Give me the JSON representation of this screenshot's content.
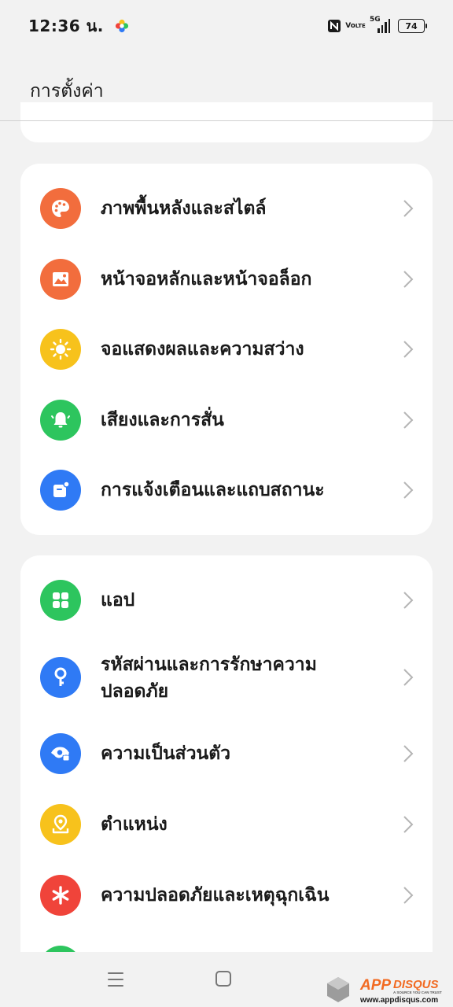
{
  "status_bar": {
    "time": "12:36 น.",
    "volte_line1": "Vo",
    "volte_line2": "LTE",
    "network": "5G",
    "battery": "74"
  },
  "header": {
    "title": "การตั้งค่า"
  },
  "groups": [
    {
      "items": [
        {
          "label": "ภาพพื้นหลังและสไตล์",
          "icon": "palette-icon",
          "color": "#f26d3d"
        },
        {
          "label": "หน้าจอหลักและหน้าจอล็อก",
          "icon": "image-icon",
          "color": "#f26d3d"
        },
        {
          "label": "จอแสดงผลและความสว่าง",
          "icon": "sun-icon",
          "color": "#f7c21c"
        },
        {
          "label": "เสียงและการสั่น",
          "icon": "bell-icon",
          "color": "#2dc55e"
        },
        {
          "label": "การแจ้งเตือนและแถบสถานะ",
          "icon": "notification-icon",
          "color": "#2f7af5"
        }
      ]
    },
    {
      "items": [
        {
          "label": "แอป",
          "icon": "apps-grid-icon",
          "color": "#2dc55e"
        },
        {
          "label_line1": "รหัสผ่านและการรักษาความ",
          "label_line2": "ปลอดภัย",
          "icon": "key-icon",
          "color": "#2f7af5"
        },
        {
          "label": "ความเป็นส่วนตัว",
          "icon": "privacy-eye-icon",
          "color": "#2f7af5"
        },
        {
          "label": "ตำแหน่ง",
          "icon": "location-pin-icon",
          "color": "#f7c21c"
        },
        {
          "label": "ความปลอดภัยและเหตุฉุกเฉิน",
          "icon": "asterisk-icon",
          "color": "#f0443a"
        }
      ]
    }
  ],
  "watermark": {
    "brand_a": "APP",
    "brand_b": "DISQUS",
    "tagline": "A SOURCE YOU CAN TRUST",
    "url": "www.appdisqus.com"
  }
}
